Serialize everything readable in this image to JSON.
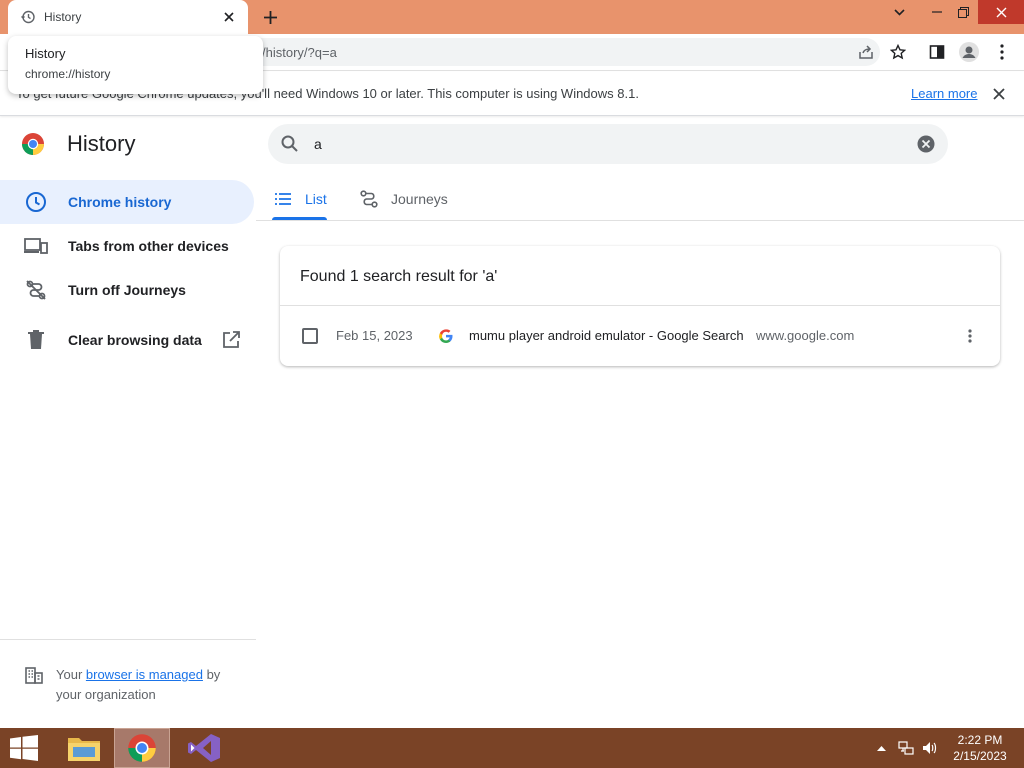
{
  "browser": {
    "tab_title": "History",
    "url": "/history/?q=a",
    "hovercard": {
      "title": "History",
      "url": "chrome://history"
    },
    "infobar": {
      "message": "To get future Google Chrome updates, you'll need Windows 10 or later. This computer is using Windows 8.1.",
      "link": "Learn more"
    }
  },
  "page": {
    "title": "History",
    "search": {
      "value": "a"
    },
    "sidebar": {
      "items": [
        {
          "label": "Chrome history",
          "icon": "clock-icon"
        },
        {
          "label": "Tabs from other devices",
          "icon": "devices-icon"
        },
        {
          "label": "Turn off Journeys",
          "icon": "journeys-off-icon"
        },
        {
          "label": "Clear browsing data",
          "icon": "trash-icon"
        }
      ],
      "managed": {
        "prefix": "Your ",
        "link": "browser is managed",
        "suffix": " by your organization"
      }
    },
    "view_tabs": [
      {
        "label": "List",
        "icon": "list-icon"
      },
      {
        "label": "Journeys",
        "icon": "journeys-icon"
      }
    ],
    "results": {
      "header": "Found 1 search result for 'a'",
      "rows": [
        {
          "date": "Feb 15, 2023",
          "title": "mumu player android emulator - Google Search",
          "domain": "www.google.com"
        }
      ]
    }
  },
  "taskbar": {
    "time": "2:22 PM",
    "date": "2/15/2023"
  },
  "colors": {
    "accent": "#1a73e8",
    "titlebar": "#e8936c",
    "taskbar": "#7a4326",
    "active_nav_bg": "#e8f0fe"
  }
}
